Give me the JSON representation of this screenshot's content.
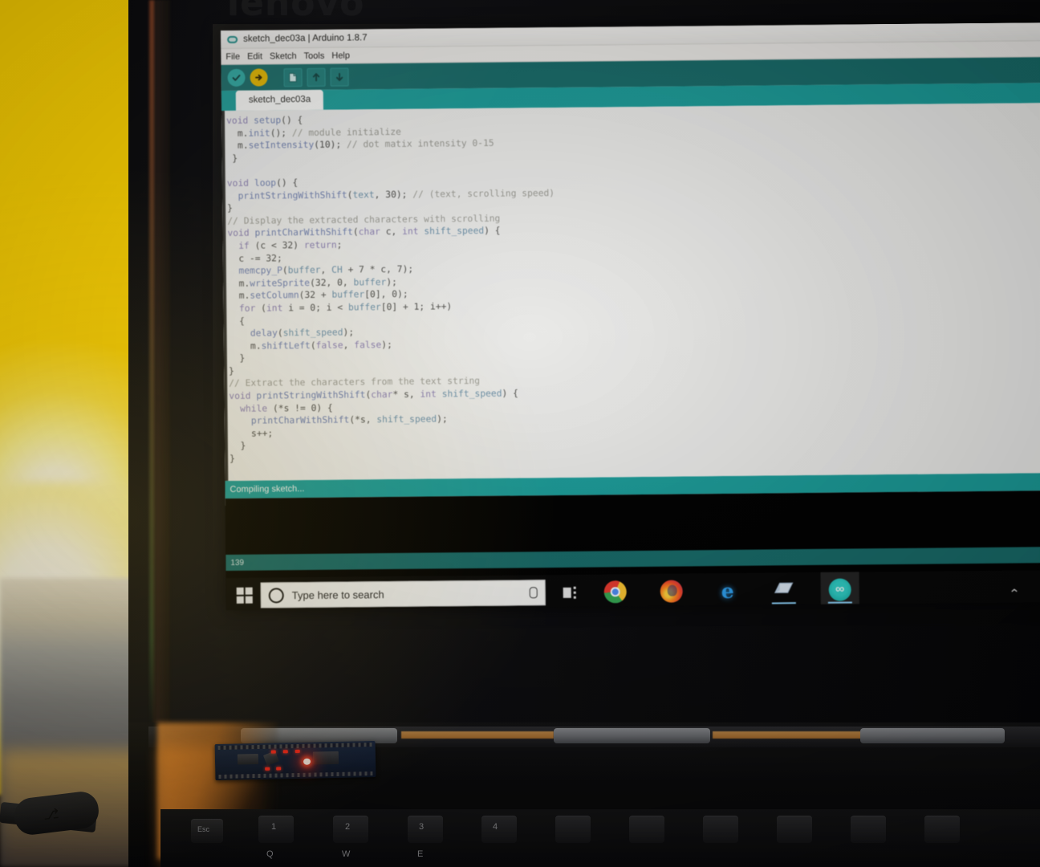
{
  "scene": {
    "brand_logo": "lenovo"
  },
  "window": {
    "title": "sketch_dec03a | Arduino 1.8.7",
    "app_icon": "arduino-infinity-icon",
    "menu": [
      "File",
      "Edit",
      "Sketch",
      "Tools",
      "Help"
    ],
    "toolbar": [
      {
        "name": "verify-button",
        "icon": "check-icon",
        "color": "#2aa6a0"
      },
      {
        "name": "upload-button",
        "icon": "arrow-right-icon",
        "color": "#e0b400"
      },
      {
        "name": "new-button",
        "icon": "document-icon"
      },
      {
        "name": "open-button",
        "icon": "arrow-up-icon"
      },
      {
        "name": "save-button",
        "icon": "arrow-down-icon"
      }
    ],
    "tab": "sketch_dec03a",
    "status_message": "Compiling sketch...",
    "line_indicator": "139",
    "accent_color": "#1a9a97",
    "toolbar_color": "#176a68"
  },
  "code": {
    "lines": [
      "void setup() {",
      "  m.init(); // module initialize",
      "  m.setIntensity(10); // dot matix intensity 0-15",
      " }",
      "",
      "void loop() {",
      "  printStringWithShift(text, 30); // (text, scrolling speed)",
      "}",
      "// Display the extracted characters with scrolling",
      "void printCharWithShift(char c, int shift_speed) {",
      "  if (c < 32) return;",
      "  c -= 32;",
      "  memcpy_P(buffer, CH + 7 * c, 7);",
      "  m.writeSprite(32, 0, buffer);",
      "  m.setColumn(32 + buffer[0], 0);",
      "  for (int i = 0; i < buffer[0] + 1; i++)",
      "  {",
      "    delay(shift_speed);",
      "    m.shiftLeft(false, false);",
      "  }",
      "}",
      "// Extract the characters from the text string",
      "void printStringWithShift(char* s, int shift_speed) {",
      "  while (*s != 0) {",
      "    printCharWithShift(*s, shift_speed);",
      "    s++;",
      "  }",
      "}"
    ]
  },
  "taskbar": {
    "start_icon": "windows-logo-icon",
    "search_placeholder": "Type here to search",
    "search_icon": "search-circle-icon",
    "mic_icon": "microphone-icon",
    "task_view_icon": "task-view-icon",
    "apps": [
      {
        "name": "taskbar-chrome",
        "label": "Google Chrome",
        "icon": "chrome-icon"
      },
      {
        "name": "taskbar-firefox",
        "label": "Mozilla Firefox",
        "icon": "firefox-icon"
      },
      {
        "name": "taskbar-edge",
        "label": "Microsoft Edge",
        "icon": "edge-icon",
        "glyph": "e"
      },
      {
        "name": "taskbar-explorer",
        "label": "File Explorer",
        "icon": "folder-icon",
        "running": true
      },
      {
        "name": "taskbar-arduino",
        "label": "Arduino IDE",
        "icon": "arduino-icon",
        "running": true,
        "active": true
      }
    ],
    "tray_expand_icon": "chevron-up-icon",
    "tray_expand_glyph": "⌃"
  },
  "hardware": {
    "board": "arduino-nano",
    "board_led": "red-power-led",
    "cable": "usb-cable",
    "cable_symbol": "⎇",
    "keys": [
      "Esc",
      "1",
      "2",
      "3",
      "4",
      "Q",
      "W",
      "E"
    ]
  }
}
